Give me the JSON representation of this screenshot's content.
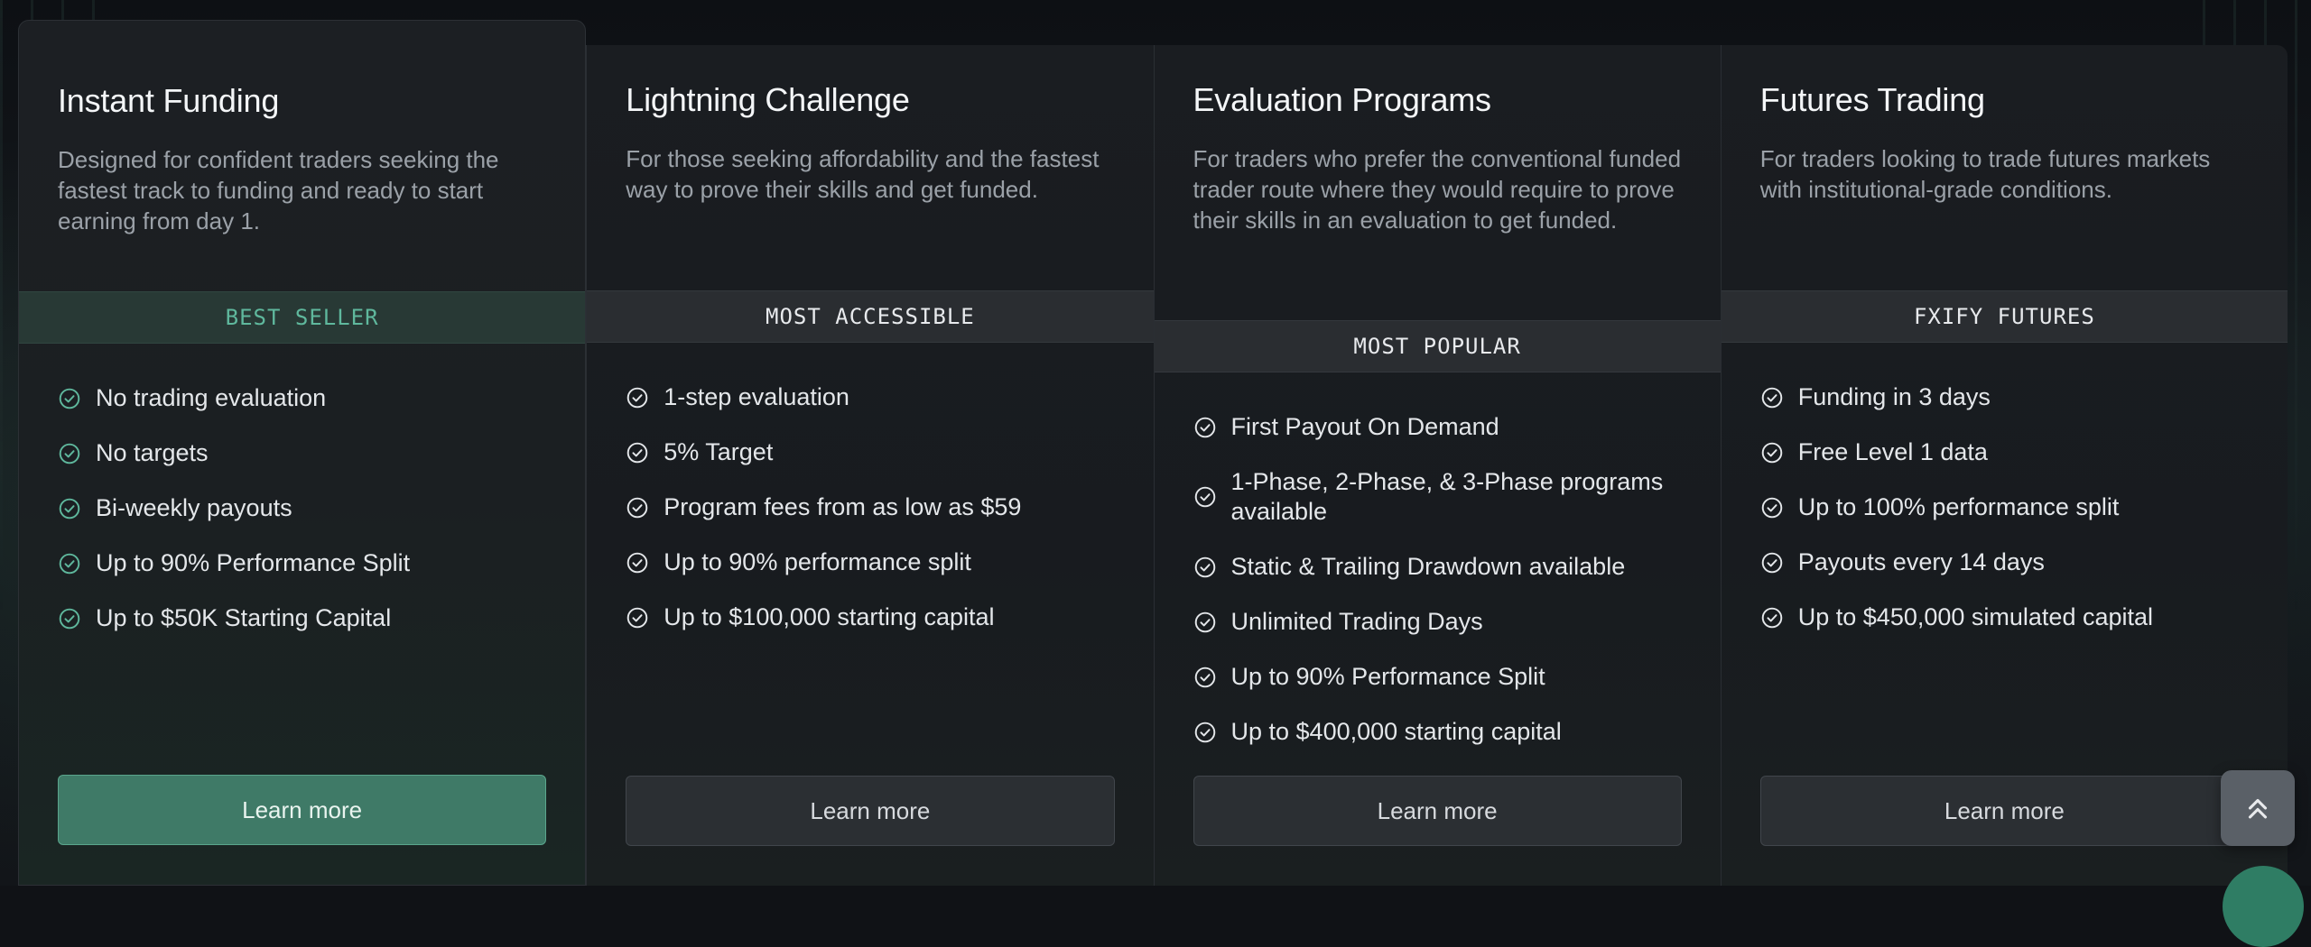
{
  "cards": [
    {
      "title": "Instant Funding",
      "description": "Designed for confident traders seeking the fastest track to funding and ready to start earning from day 1.",
      "badge": "BEST SELLER",
      "features": [
        "No trading evaluation",
        "No targets",
        "Bi-weekly payouts",
        "Up to 90% Performance Split",
        "Up to $50K Starting Capital"
      ],
      "button": "Learn more"
    },
    {
      "title": "Lightning Challenge",
      "description": "For those seeking affordability and the fastest way to prove their skills and get funded.",
      "badge": "MOST ACCESSIBLE",
      "features": [
        "1-step evaluation",
        "5% Target",
        "Program fees from as low as $59",
        "Up to 90% performance split",
        "Up to $100,000 starting capital"
      ],
      "button": "Learn more"
    },
    {
      "title": "Evaluation Programs",
      "description": "For traders who prefer the conventional funded trader route where they would require to prove their skills in an evaluation to get funded.",
      "badge": "MOST POPULAR",
      "features": [
        "First Payout On Demand",
        "1-Phase, 2-Phase, & 3-Phase programs available",
        "Static & Trailing Drawdown available",
        "Unlimited Trading Days",
        "Up to 90% Performance Split",
        "Up to $400,000 starting capital"
      ],
      "button": "Learn more"
    },
    {
      "title": "Futures Trading",
      "description": "For traders looking to trade futures markets with institutional-grade conditions.",
      "badge": "FXIFY FUTURES",
      "features": [
        "Funding in 3 days",
        "Free Level 1 data",
        "Up to 100% performance split",
        "Payouts every 14 days",
        "Up to $450,000 simulated capital"
      ],
      "button": "Learn more"
    }
  ],
  "icons": {
    "feature": "check-circle-icon",
    "scroll": "double-chevron-up-icon",
    "chat": "chat-bubble-icon"
  },
  "colors": {
    "accent_green": "#3f7a67",
    "badge_green_text": "#5fb89d",
    "background": "#101216"
  }
}
